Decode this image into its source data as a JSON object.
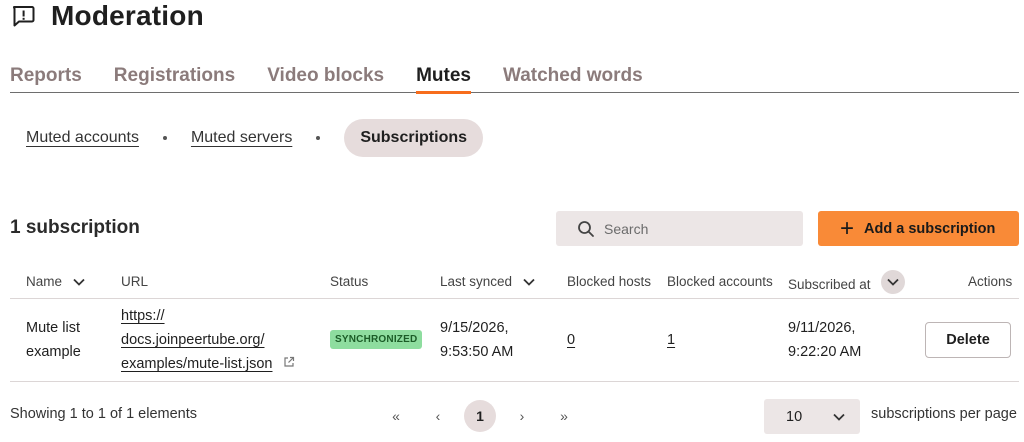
{
  "header": {
    "title": "Moderation",
    "icon": "alert-message-icon"
  },
  "tabs": [
    {
      "label": "Reports",
      "active": false
    },
    {
      "label": "Registrations",
      "active": false
    },
    {
      "label": "Video blocks",
      "active": false
    },
    {
      "label": "Mutes",
      "active": true
    },
    {
      "label": "Watched words",
      "active": false
    }
  ],
  "subnav": {
    "muted_accounts": "Muted accounts",
    "muted_servers": "Muted servers",
    "subscriptions": "Subscriptions"
  },
  "list": {
    "count_title": "1 subscription",
    "search_placeholder": "Search",
    "add_label": "Add a subscription"
  },
  "table": {
    "headers": {
      "name": "Name",
      "url": "URL",
      "status": "Status",
      "last_synced": "Last synced",
      "blocked_hosts": "Blocked hosts",
      "blocked_accounts": "Blocked accounts",
      "subscribed_at": "Subscribed at",
      "actions": "Actions"
    },
    "rows": [
      {
        "name_line1": "Mute list",
        "name_line2": "example",
        "url_line1": "https://",
        "url_line2": "docs.joinpeertube.org/",
        "url_line3": "examples/mute-list.json",
        "status": "SYNCHRONIZED",
        "last_synced_date": "9/15/2026,",
        "last_synced_time": "9:53:50 AM",
        "blocked_hosts": "0",
        "blocked_accounts": "1",
        "subscribed_date": "9/11/2026,",
        "subscribed_time": "9:22:20 AM",
        "action_label": "Delete"
      }
    ]
  },
  "pagination": {
    "summary": "Showing 1 to 1 of 1 elements",
    "first": "«",
    "prev": "‹",
    "current": "1",
    "next": "›",
    "last": "»",
    "per_page_value": "10",
    "per_page_label": "subscriptions per page"
  },
  "colors": {
    "accent": "#f76d1d",
    "primary_button": "#f98a37",
    "status_badge_bg": "#8edd9f",
    "status_badge_text": "#1b5c27",
    "pill_bg": "#e6dcdc",
    "inactive_tab": "#8b7b7b"
  }
}
